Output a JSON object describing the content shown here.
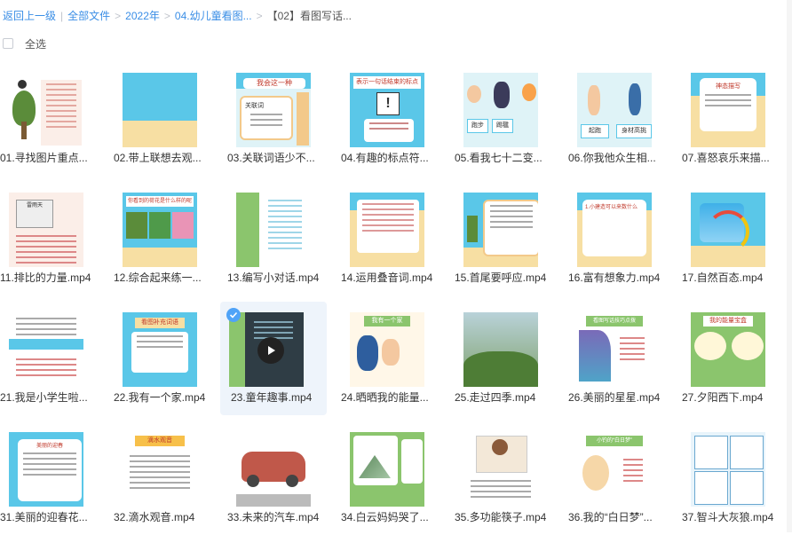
{
  "breadcrumb": {
    "back": "返回上一级",
    "items": [
      "全部文件",
      "2022年",
      "04.幼儿童看图..."
    ],
    "current": "【02】看图写话..."
  },
  "select_all": "全选",
  "files": [
    {
      "name": "01.寻找图片重点...",
      "thumb": "t1"
    },
    {
      "name": "02.带上联想去观...",
      "thumb": "t2"
    },
    {
      "name": "03.关联词语少不...",
      "thumb": "t3"
    },
    {
      "name": "04.有趣的标点符...",
      "thumb": "t4"
    },
    {
      "name": "05.看我七十二变...",
      "thumb": "t5"
    },
    {
      "name": "06.你我他众生相...",
      "thumb": "t6"
    },
    {
      "name": "07.喜怒哀乐来描...",
      "thumb": "t7"
    },
    {
      "name": "11.排比的力量.mp4",
      "thumb": "t11"
    },
    {
      "name": "12.综合起来练一...",
      "thumb": "t12"
    },
    {
      "name": "13.编写小对话.mp4",
      "thumb": "t13"
    },
    {
      "name": "14.运用叠音词.mp4",
      "thumb": "t14"
    },
    {
      "name": "15.首尾要呼应.mp4",
      "thumb": "t15"
    },
    {
      "name": "16.富有想象力.mp4",
      "thumb": "t16"
    },
    {
      "name": "17.自然百态.mp4",
      "thumb": "t17"
    },
    {
      "name": "21.我是小学生啦...",
      "thumb": "t21"
    },
    {
      "name": "22.我有一个家.mp4",
      "thumb": "t22"
    },
    {
      "name": "23.童年趣事.mp4",
      "thumb": "t23"
    },
    {
      "name": "24.晒晒我的能量...",
      "thumb": "t24"
    },
    {
      "name": "25.走过四季.mp4",
      "thumb": "t25"
    },
    {
      "name": "26.美丽的星星.mp4",
      "thumb": "t26"
    },
    {
      "name": "27.夕阳西下.mp4",
      "thumb": "t27"
    },
    {
      "name": "31.美丽的迎春花...",
      "thumb": "t31"
    },
    {
      "name": "32.滴水观音.mp4",
      "thumb": "t32"
    },
    {
      "name": "33.未来的汽车.mp4",
      "thumb": "t33"
    },
    {
      "name": "34.白云妈妈哭了...",
      "thumb": "t34"
    },
    {
      "name": "35.多功能筷子.mp4",
      "thumb": "t35"
    },
    {
      "name": "36.我的“白日梦”...",
      "thumb": "t36"
    },
    {
      "name": "37.智斗大灰狼.mp4",
      "thumb": "t37"
    }
  ],
  "thumb_text": {
    "t3": "我会这一种",
    "t3b": "关联词",
    "t4": "表示一句话结束的标点",
    "t4b": "!",
    "t5": [
      "跑步",
      "踢毽"
    ],
    "t6": [
      "起跑",
      "身材高挑"
    ],
    "t7": "神态描写",
    "t11": "雷雨天",
    "t12": "你看到的荷花是什么样的呢",
    "t16": "1.小建造可以来数什么",
    "t22": "看图补充词语",
    "t24": "我有一个家",
    "t26": "看图写话技巧点拨",
    "t27": "我的能量宝盒",
    "t31": "美丽的迎春",
    "t32": "滴水观音",
    "t36": "小钓的“白日梦”"
  },
  "colors": {
    "link": "#3a8ee6",
    "hover_bg": "#eef4fb",
    "check": "#4fa3f7"
  },
  "selected_file": "23.童年趣事.mp4"
}
